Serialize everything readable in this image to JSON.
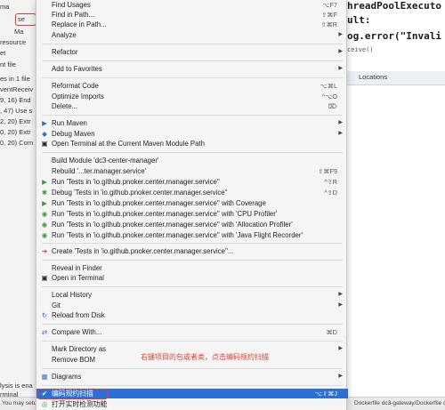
{
  "background": {
    "left_rows": [
      "ma",
      "se",
      "Ma",
      "resource",
      "et",
      "nt file",
      "es in 1 file",
      "ventReceiv",
      "9, 16) End",
      ", 47) Use s",
      "2, 20) Extr",
      "0, 20) Extr",
      "0, 20) Com",
      "lysis is ena",
      "rminal"
    ],
    "code_lines": [
      "hreadPoolExecuto",
      "ult:",
      "og.error(\"Invali",
      "ceive()"
    ],
    "locations_tab": "Locations",
    "status_left": "You may setu",
    "status_right": "Dockerfile dc3-gateway/Dockerfile dc3-gateway"
  },
  "menu": {
    "items": [
      {
        "label": "Find Usages",
        "shortcut": "⌥F7",
        "icon": ""
      },
      {
        "label": "Find in Path...",
        "shortcut": "⇧⌘F",
        "icon": ""
      },
      {
        "label": "Replace in Path...",
        "shortcut": "⇧⌘R",
        "icon": ""
      },
      {
        "label": "Analyze",
        "shortcut": "",
        "icon": ""
      },
      {
        "label": "Refactor",
        "shortcut": "",
        "icon": ""
      },
      {
        "label": "Add to Favorites",
        "shortcut": "",
        "icon": ""
      },
      {
        "label": "Reformat Code",
        "shortcut": "⌥⌘L",
        "icon": ""
      },
      {
        "label": "Optimize Imports",
        "shortcut": "^⌥O",
        "icon": ""
      },
      {
        "label": "Delete...",
        "shortcut": "⌦",
        "icon": ""
      },
      {
        "label": "Run Maven",
        "shortcut": "",
        "icon": "maven-icon"
      },
      {
        "label": "Debug Maven",
        "shortcut": "",
        "icon": "maven-icon"
      },
      {
        "label": "Open Terminal at the Current Maven Module Path",
        "shortcut": "",
        "icon": "terminal-icon"
      },
      {
        "label": "Build Module 'dc3-center-manager'",
        "shortcut": "",
        "icon": ""
      },
      {
        "label": "Rebuild '...ter.manager.service'",
        "shortcut": "⇧⌘F9",
        "icon": ""
      },
      {
        "label": "Run 'Tests in 'io.github.pnoker.center.manager.service''",
        "shortcut": "^⇧R",
        "icon": "run-icon"
      },
      {
        "label": "Debug 'Tests in 'io.github.pnoker.center.manager.service''",
        "shortcut": "^⇧D",
        "icon": "debug-icon"
      },
      {
        "label": "Run 'Tests in 'io.github.pnoker.center.manager.service'' with Coverage",
        "shortcut": "",
        "icon": "coverage-icon"
      },
      {
        "label": "Run 'Tests in 'io.github.pnoker.center.manager.service'' with 'CPU Profiler'",
        "shortcut": "",
        "icon": "profiler-icon"
      },
      {
        "label": "Run 'Tests in 'io.github.pnoker.center.manager.service'' with 'Allocation Profiler'",
        "shortcut": "",
        "icon": "profiler-icon"
      },
      {
        "label": "Run 'Tests in 'io.github.pnoker.center.manager.service'' with 'Java Flight Recorder'",
        "shortcut": "",
        "icon": "profiler-icon"
      },
      {
        "label": "Create 'Tests in 'io.github.pnoker.center.manager.service''...",
        "shortcut": "",
        "icon": "create-icon"
      },
      {
        "label": "Reveal in Finder",
        "shortcut": "",
        "icon": ""
      },
      {
        "label": "Open in Terminal",
        "shortcut": "",
        "icon": "terminal-icon"
      },
      {
        "label": "Local History",
        "shortcut": "",
        "icon": ""
      },
      {
        "label": "Git",
        "shortcut": "",
        "icon": ""
      },
      {
        "label": "Reload from Disk",
        "shortcut": "",
        "icon": "reload-icon"
      },
      {
        "label": "Compare With...",
        "shortcut": "⌘D",
        "icon": "compare-icon"
      },
      {
        "label": "Mark Directory as",
        "shortcut": "",
        "icon": ""
      },
      {
        "label": "Remove BOM",
        "shortcut": "",
        "icon": ""
      },
      {
        "label": "Diagrams",
        "shortcut": "",
        "icon": "diagrams-icon"
      },
      {
        "label": "编码规约扫描",
        "shortcut": "⌥⇧⌘J",
        "icon": "scan-icon"
      },
      {
        "label": "打开实时检测功能",
        "shortcut": "",
        "icon": "realtime-icon"
      }
    ],
    "annotation": "右键项目的包或者类，点击编码规约扫描"
  },
  "colors": {
    "highlight": "#2b6fd6",
    "annotation_red": "#e23b2e",
    "menu_bg": "#f5f5f5"
  }
}
